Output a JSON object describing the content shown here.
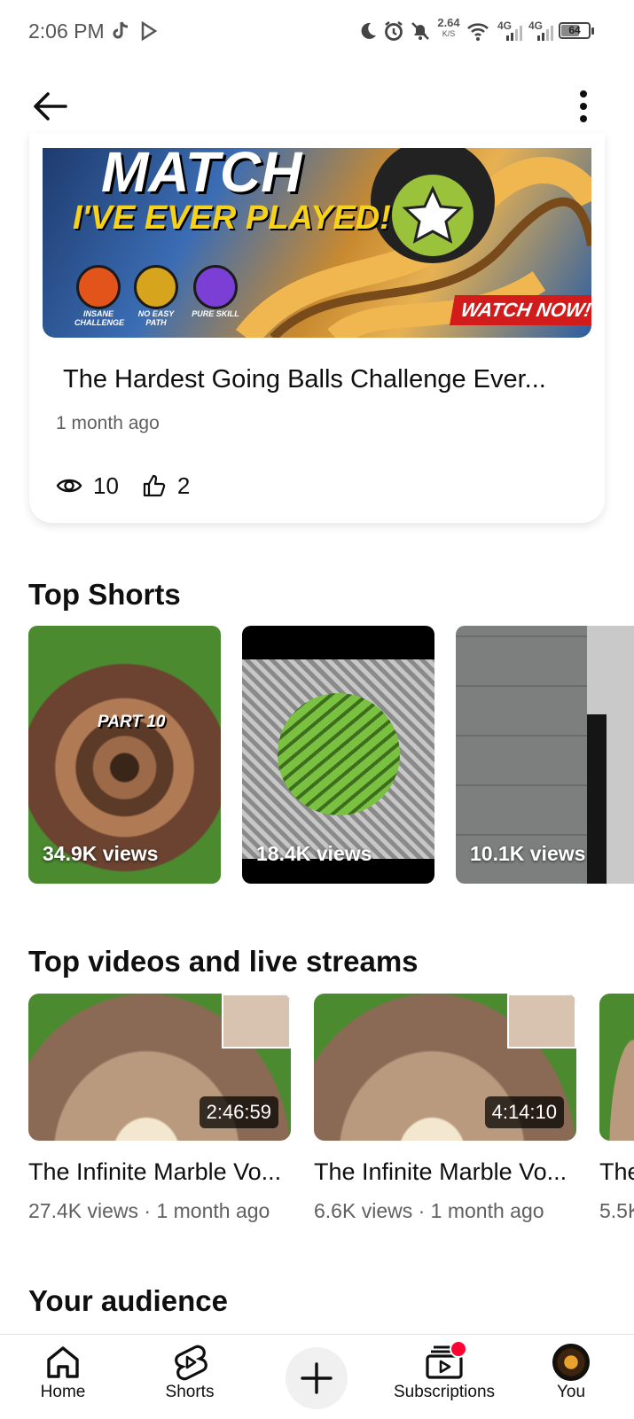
{
  "status_bar": {
    "time": "2:06 PM",
    "net_speed_value": "2.64",
    "net_speed_unit": "K/S",
    "signal1": "4G",
    "signal2": "4G",
    "battery": "64"
  },
  "header": {
    "back_icon": "arrow-left-icon",
    "more_icon": "more-vertical-icon"
  },
  "latest_video": {
    "thumb_text_line1": "MATCH",
    "thumb_text_line2": "I'VE EVER PLAYED!",
    "badge1": "INSANE CHALLENGE",
    "badge2": "NO EASY PATH",
    "badge3": "PURE SKILL",
    "cta": "WATCH NOW!",
    "title": "The Hardest Going Balls Challenge Ever...",
    "age": "1 month ago",
    "views": "10",
    "likes": "2"
  },
  "top_shorts": {
    "title": "Top Shorts",
    "items": [
      {
        "views": "34.9K views",
        "overlay": "PART 10"
      },
      {
        "views": "18.4K views"
      },
      {
        "views": "10.1K views"
      }
    ]
  },
  "top_videos": {
    "title": "Top videos and live streams",
    "items": [
      {
        "title": "The Infinite Marble Vo...",
        "meta": "27.4K views · 1 month ago",
        "duration": "2:46:59"
      },
      {
        "title": "The Infinite Marble Vo...",
        "meta": "6.6K views · 1 month ago",
        "duration": "4:14:10"
      },
      {
        "title": "The",
        "meta": "5.5K"
      }
    ]
  },
  "audience": {
    "title": "Your audience"
  },
  "bottom_nav": {
    "home": "Home",
    "shorts": "Shorts",
    "subscriptions": "Subscriptions",
    "you": "You"
  },
  "colors": {
    "accent_red": "#ff0033",
    "text": "#0f0f0f",
    "secondary_text": "#606060"
  }
}
